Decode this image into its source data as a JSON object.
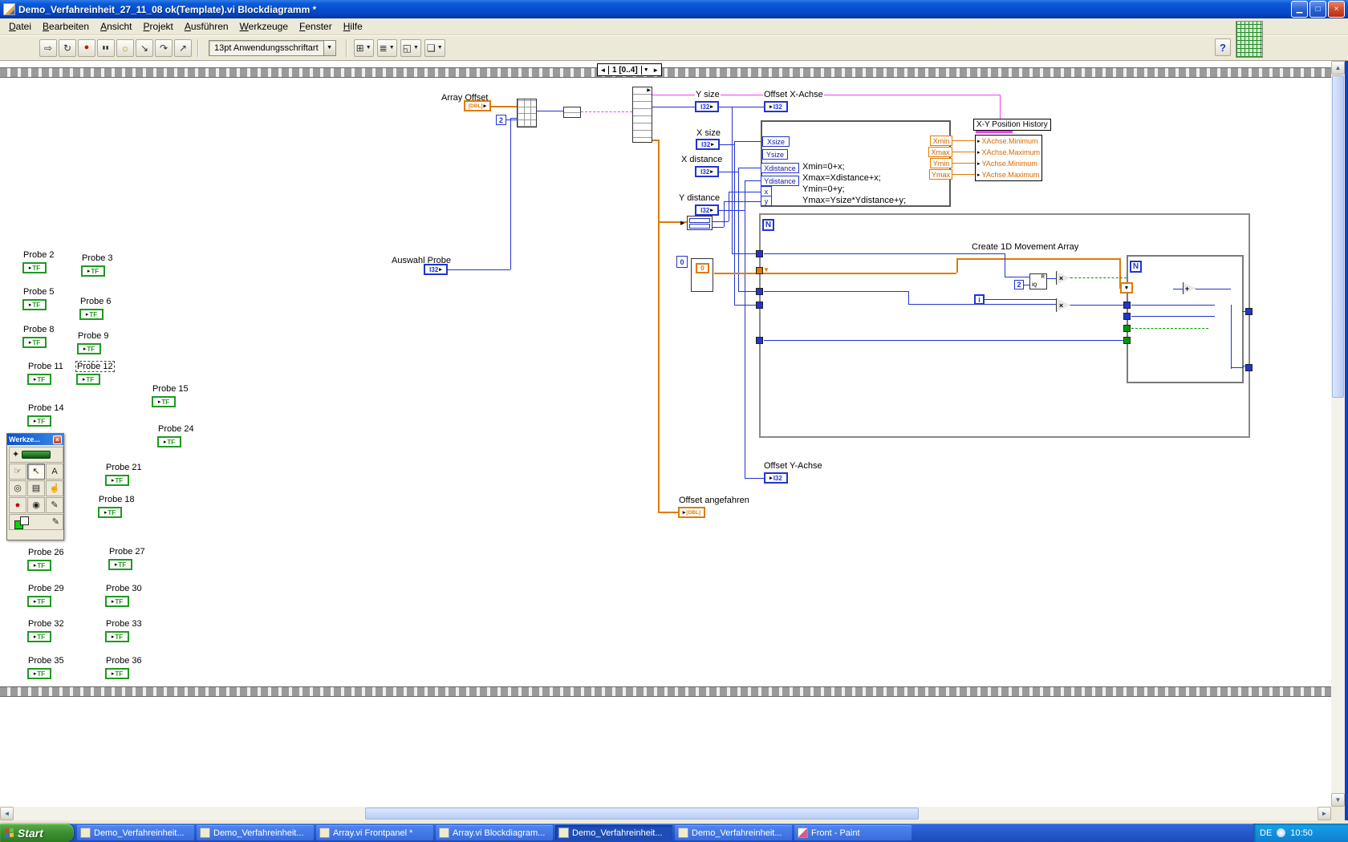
{
  "window": {
    "title": "Demo_Verfahreinheit_27_11_08 ok(Template).vi Blockdiagramm *"
  },
  "menu": {
    "items": [
      "Datei",
      "Bearbeiten",
      "Ansicht",
      "Projekt",
      "Ausführen",
      "Werkzeuge",
      "Fenster",
      "Hilfe"
    ]
  },
  "toolbar": {
    "buttons": [
      "run-icon",
      "run-continuous-icon",
      "abort-icon",
      "pause-icon",
      "highlight-execution-icon",
      "step-into-icon",
      "step-over-icon",
      "step-out-icon"
    ],
    "dropdowns": [
      "align-objects-icon",
      "distribute-objects-icon",
      "resize-objects-icon",
      "reorder-icon"
    ],
    "font_selector": "13pt Anwendungsschriftart",
    "help_label": "?"
  },
  "sequence": {
    "selector_label": "1 [0..4]"
  },
  "diagram": {
    "labels": {
      "array_offset": "Array Offset",
      "auswahl_probe": "Auswahl Probe",
      "y_size": "Y size",
      "x_size": "X size",
      "x_distance": "X distance",
      "y_distance": "Y distance",
      "offset_x_achse": "Offset X-Achse",
      "offset_y_achse": "Offset Y-Achse",
      "offset_angefahren": "Offset angefahren",
      "create_movement": "Create 1D Movement Array"
    },
    "formula_node": {
      "lines": [
        "Xmin=0+x;",
        "Xmax=Xdistance+x;",
        "Ymin=0+y;",
        "Ymax=Ysize*Ydistance+y;"
      ],
      "inputs": [
        "Xsize",
        "Ysize",
        "Xdistance",
        "Ydistance",
        "x",
        "y"
      ],
      "outputs": [
        "Xmin",
        "Xmax",
        "Ymin",
        "Ymax"
      ]
    },
    "property_node": {
      "title": "X-Y Position History",
      "items": [
        "XAchse.Minimum",
        "XAchse.Maximum",
        "YAchse.Minimum",
        "YAchse.Maximum"
      ]
    },
    "probes": [
      "Probe 2",
      "Probe 3",
      "Probe 5",
      "Probe 6",
      "Probe 8",
      "Probe 9",
      "Probe 11",
      "Probe 12",
      "Probe 14",
      "Probe 15",
      "Probe 24",
      "Probe 21",
      "Probe 18",
      "Probe 26",
      "Probe 27",
      "Probe 29",
      "Probe 30",
      "Probe 32",
      "Probe 33",
      "Probe 35",
      "Probe 36"
    ],
    "probe_terminal": "TF",
    "terminals": {
      "int": "I32",
      "count": "N",
      "iterator": "i",
      "two": "2",
      "zero": "0",
      "dbl_array": "[DBL]",
      "r": "R",
      "iq": "IQ"
    }
  },
  "tools_palette": {
    "title": "Werkze...",
    "tools": [
      "auto-select-tool",
      "operate-tool",
      "position-tool",
      "label-tool",
      "wire-tool",
      "menu-tool",
      "scroll-tool",
      "breakpoint-tool",
      "probe-tool",
      "color-copy-tool",
      "color-tool"
    ]
  },
  "taskbar": {
    "start_label": "Start",
    "buttons": [
      {
        "label": "Demo_Verfahreinheit...",
        "app": "labview",
        "active": false
      },
      {
        "label": "Demo_Verfahreinheit...",
        "app": "labview",
        "active": false
      },
      {
        "label": "Array.vi Frontpanel *",
        "app": "labview",
        "active": false
      },
      {
        "label": "Array.vi Blockdiagram...",
        "app": "labview",
        "active": false
      },
      {
        "label": "Demo_Verfahreinheit...",
        "app": "labview",
        "active": true
      },
      {
        "label": "Demo_Verfahreinheit...",
        "app": "labview",
        "active": false
      },
      {
        "label": "Front - Paint",
        "app": "paint",
        "active": false
      }
    ],
    "tray": {
      "language": "DE",
      "time": "10:50"
    }
  }
}
